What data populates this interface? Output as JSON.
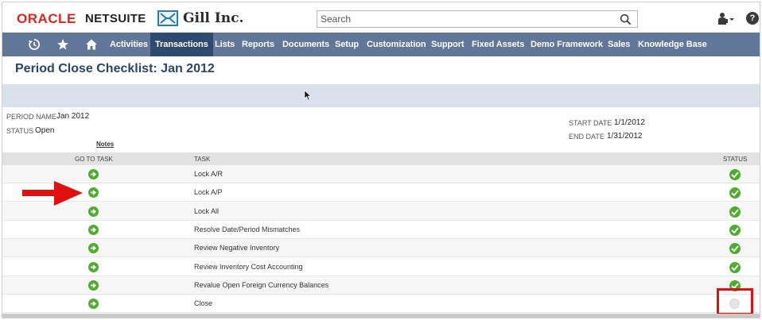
{
  "header": {
    "brand_oracle": "ORACLE",
    "brand_netsuite": "NETSUITE",
    "company_name": "Gill Inc.",
    "search_placeholder": "Search",
    "help_label": "?"
  },
  "nav": {
    "items": [
      {
        "label": "Activities"
      },
      {
        "label": "Transactions"
      },
      {
        "label": "Lists"
      },
      {
        "label": "Reports"
      },
      {
        "label": "Documents"
      },
      {
        "label": "Setup"
      },
      {
        "label": "Customization"
      },
      {
        "label": "Support"
      },
      {
        "label": "Fixed Assets"
      },
      {
        "label": "Demo Framework"
      },
      {
        "label": "Sales"
      },
      {
        "label": "Knowledge Base"
      }
    ],
    "active": "Transactions"
  },
  "page": {
    "title": "Period Close Checklist: Jan 2012"
  },
  "info": {
    "period_name_label": "PERIOD NAME",
    "period_name_value": "Jan 2012",
    "status_label": "STATUS",
    "status_value": "Open",
    "notes_label": "Notes",
    "start_date_label": "START DATE",
    "start_date_value": "1/1/2012",
    "end_date_label": "END DATE",
    "end_date_value": "1/31/2012"
  },
  "table": {
    "columns": {
      "goto": "GO TO TASK",
      "task": "TASK",
      "status": "STATUS"
    },
    "rows": [
      {
        "task": "Lock A/R",
        "status": "complete"
      },
      {
        "task": "Lock A/P",
        "status": "complete"
      },
      {
        "task": "Lock All",
        "status": "complete"
      },
      {
        "task": "Resolve Date/Period Mismatches",
        "status": "complete"
      },
      {
        "task": "Review Negative Inventory",
        "status": "complete"
      },
      {
        "task": "Review Inventory Cost Accounting",
        "status": "complete"
      },
      {
        "task": "Revalue Open Foreign Currency Balances",
        "status": "complete"
      },
      {
        "task": "Close",
        "status": "pending"
      }
    ]
  },
  "colors": {
    "brand_red": "#e2231a",
    "nav_bg": "#607799",
    "nav_active": "#2e4a6e",
    "title_blue": "#2c4564",
    "status_green": "#4cae2c",
    "annotation_red": "#e01010"
  }
}
